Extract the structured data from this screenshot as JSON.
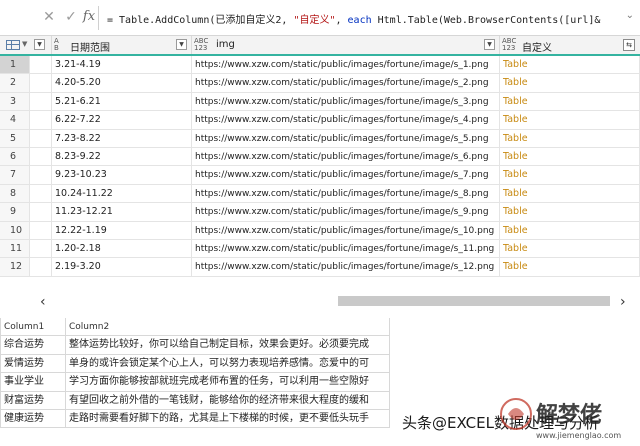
{
  "formula_bar": {
    "cancel_icon": "close-icon",
    "accept_icon": "check-icon",
    "fx_label": "fx",
    "formula_prefix": "= Table.AddColumn(已添加自定义2, ",
    "formula_string": "\"自定义\"",
    "formula_middle": ", ",
    "formula_keyword": "each",
    "formula_suffix": " Html.Table(Web.BrowserContents([url]&",
    "expand_glyph": "⌄"
  },
  "columns": [
    {
      "type_top": "A",
      "type_bottom": "B",
      "type_sub": "C",
      "name": "日期范围"
    },
    {
      "type_top": "ABC",
      "type_bottom": "123",
      "name": "img"
    },
    {
      "type_top": "ABC",
      "type_bottom": "123",
      "name": "自定义"
    }
  ],
  "rows": [
    {
      "idx": "1",
      "date": "3.21-4.19",
      "img": "https://www.xzw.com/static/public/images/fortune/image/s_1.png",
      "tab": "Table"
    },
    {
      "idx": "2",
      "date": "4.20-5.20",
      "img": "https://www.xzw.com/static/public/images/fortune/image/s_2.png",
      "tab": "Table"
    },
    {
      "idx": "3",
      "date": "5.21-6.21",
      "img": "https://www.xzw.com/static/public/images/fortune/image/s_3.png",
      "tab": "Table"
    },
    {
      "idx": "4",
      "date": "6.22-7.22",
      "img": "https://www.xzw.com/static/public/images/fortune/image/s_4.png",
      "tab": "Table"
    },
    {
      "idx": "5",
      "date": "7.23-8.22",
      "img": "https://www.xzw.com/static/public/images/fortune/image/s_5.png",
      "tab": "Table"
    },
    {
      "idx": "6",
      "date": "8.23-9.22",
      "img": "https://www.xzw.com/static/public/images/fortune/image/s_6.png",
      "tab": "Table"
    },
    {
      "idx": "7",
      "date": "9.23-10.23",
      "img": "https://www.xzw.com/static/public/images/fortune/image/s_7.png",
      "tab": "Table"
    },
    {
      "idx": "8",
      "date": "10.24-11.22",
      "img": "https://www.xzw.com/static/public/images/fortune/image/s_8.png",
      "tab": "Table"
    },
    {
      "idx": "9",
      "date": "11.23-12.21",
      "img": "https://www.xzw.com/static/public/images/fortune/image/s_9.png",
      "tab": "Table"
    },
    {
      "idx": "10",
      "date": "12.22-1.19",
      "img": "https://www.xzw.com/static/public/images/fortune/image/s_10.png",
      "tab": "Table"
    },
    {
      "idx": "11",
      "date": "1.20-2.18",
      "img": "https://www.xzw.com/static/public/images/fortune/image/s_11.png",
      "tab": "Table"
    },
    {
      "idx": "12",
      "date": "2.19-3.20",
      "img": "https://www.xzw.com/static/public/images/fortune/image/s_12.png",
      "tab": "Table"
    }
  ],
  "scrollbar": {
    "left_arrow": "‹",
    "right_arrow": "›"
  },
  "preview": {
    "headers": [
      "Column1",
      "Column2"
    ],
    "rows": [
      [
        "综合运势",
        "整体运势比较好，你可以给自己制定目标，效果会更好。必须要完成"
      ],
      [
        "爱情运势",
        "单身的或许会锁定某个心上人，可以努力表现培养感情。恋爱中的可"
      ],
      [
        "事业学业",
        "学习方面你能够按部就班完成老师布置的任务，可以利用一些空隙好"
      ],
      [
        "财富运势",
        "有望回收之前外借的一笔钱财，能够给你的经济带来很大程度的缓和"
      ],
      [
        "健康运势",
        "走路时需要看好脚下的路，尤其是上下楼梯的时候，更不要低头玩手"
      ]
    ]
  },
  "watermark": {
    "text": "头条@EXCEL数据处理与分析",
    "brand_name": "解梦佬",
    "brand_url": "www.jiemenglao.com"
  },
  "colors": {
    "accent": "#34b3a0",
    "table_link": "#c88a12",
    "selected_row": "#d3d3d3"
  }
}
